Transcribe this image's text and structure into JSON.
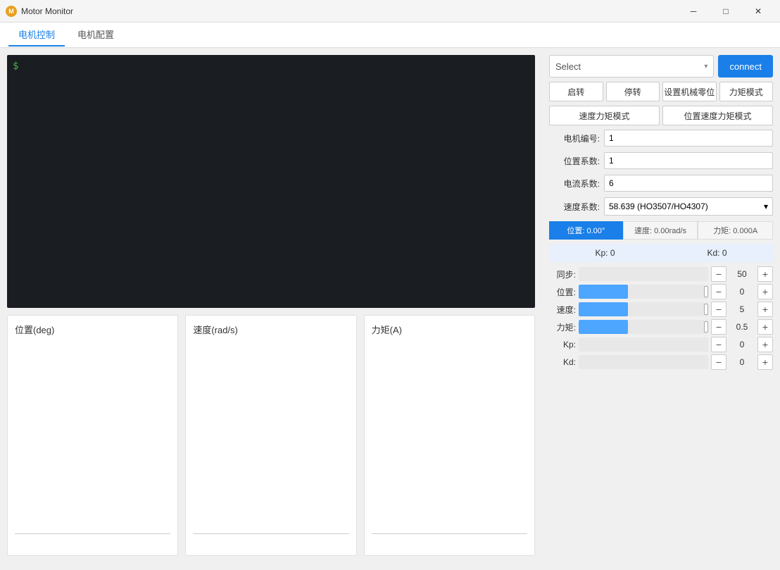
{
  "titleBar": {
    "appName": "Motor Monitor",
    "iconLabel": "M",
    "controls": {
      "minimize": "─",
      "maximize": "□",
      "close": "✕"
    }
  },
  "tabs": [
    {
      "id": "motor-control",
      "label": "电机控制",
      "active": true
    },
    {
      "id": "motor-config",
      "label": "电机配置",
      "active": false
    }
  ],
  "rightPanel": {
    "select": {
      "placeholder": "Select",
      "options": []
    },
    "connectButton": "connect",
    "controlButtons": {
      "start": "启转",
      "stop": "停转",
      "setZero": "设置机械零位",
      "torqueMode": "力矩模式"
    },
    "modeButtons": {
      "speedTorque": "速度力矩模式",
      "posSpeedTorque": "位置速度力矩模式"
    },
    "fields": {
      "motorId": {
        "label": "电机编号:",
        "value": "1"
      },
      "posCoeff": {
        "label": "位置系数:",
        "value": "1"
      },
      "currentCoeff": {
        "label": "电流系数:",
        "value": "6"
      },
      "speedCoeff": {
        "label": "速度系数:",
        "value": "58.639 (HO3507/HO4307)"
      }
    },
    "statusPills": {
      "position": "位置: 0.00°",
      "speed": "速度: 0.00rad/s",
      "torque": "力矩: 0.000A"
    },
    "kpkd": {
      "kp": "Kp: 0",
      "kd": "Kd: 0"
    },
    "sliders": [
      {
        "id": "sync",
        "label": "同步:",
        "fillPercent": 0,
        "empty": true,
        "value": "50"
      },
      {
        "id": "position",
        "label": "位置:",
        "fillPercent": 38,
        "empty": false,
        "value": "0"
      },
      {
        "id": "speed",
        "label": "速度:",
        "fillPercent": 38,
        "empty": false,
        "value": "5"
      },
      {
        "id": "torque",
        "label": "力矩:",
        "fillPercent": 38,
        "empty": false,
        "value": "0.5"
      },
      {
        "id": "kp",
        "label": "Kp:",
        "fillPercent": 0,
        "empty": true,
        "value": "0"
      },
      {
        "id": "kd",
        "label": "Kd:",
        "fillPercent": 0,
        "empty": true,
        "value": "0"
      }
    ]
  },
  "chartPanels": [
    {
      "id": "position-chart",
      "title": "位置(deg)"
    },
    {
      "id": "speed-chart",
      "title": "速度(rad/s)"
    },
    {
      "id": "torque-chart",
      "title": "力矩(A)"
    }
  ],
  "terminal": {
    "cursor": "$"
  }
}
